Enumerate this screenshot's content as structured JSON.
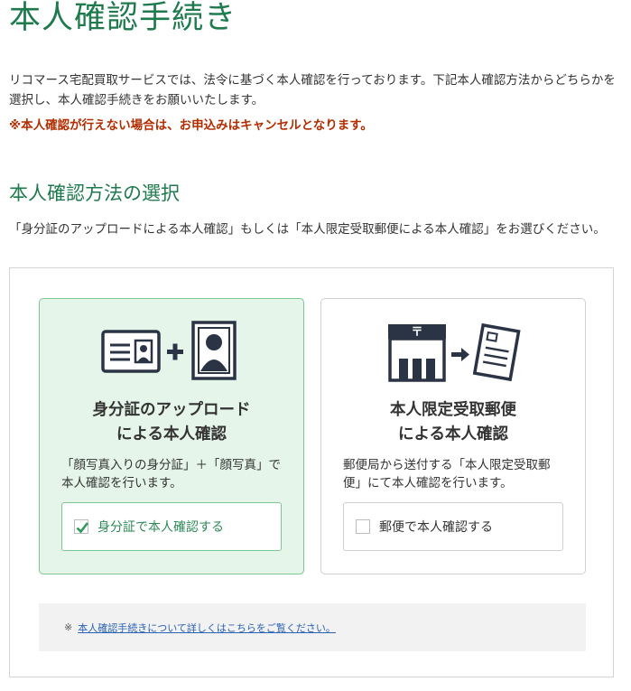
{
  "page": {
    "title": "本人確認手続き",
    "intro": "リコマース宅配買取サービスでは、法令に基づく本人確認を行っております。下記本人確認方法からどちらかを選択し、本人確認手続きをお願いいたします。",
    "warning": "※本人確認が行えない場合は、お申込みはキャンセルとなります。"
  },
  "section": {
    "heading": "本人確認方法の選択",
    "description": "「身分証のアップロードによる本人確認」もしくは「本人限定受取郵便による本人確認」をお選びください。"
  },
  "options": {
    "id_upload": {
      "title_line1": "身分証のアップロード",
      "title_line2": "による本人確認",
      "description": "「顔写真入りの身分証」＋「顔写真」で本人確認を行います。",
      "button_label": "身分証で本人確認する",
      "selected": true
    },
    "postal": {
      "title_line1": "本人限定受取郵便",
      "title_line2": "による本人確認",
      "description": "郵便局から送付する「本人限定受取郵便」にて本人確認を行います。",
      "button_label": "郵便で本人確認する",
      "selected": false,
      "post_office_mark": "〒"
    }
  },
  "note": {
    "mark": "※",
    "link_text": "本人確認手続きについて詳しくはこちらをご覧ください。"
  },
  "colors": {
    "accent_green": "#1f7a4e",
    "selected_bg": "#e6f5ea",
    "selected_border": "#7cc893",
    "warning_red": "#b22d00",
    "link_blue": "#2a62b8",
    "icon_dark": "#2b3445"
  }
}
